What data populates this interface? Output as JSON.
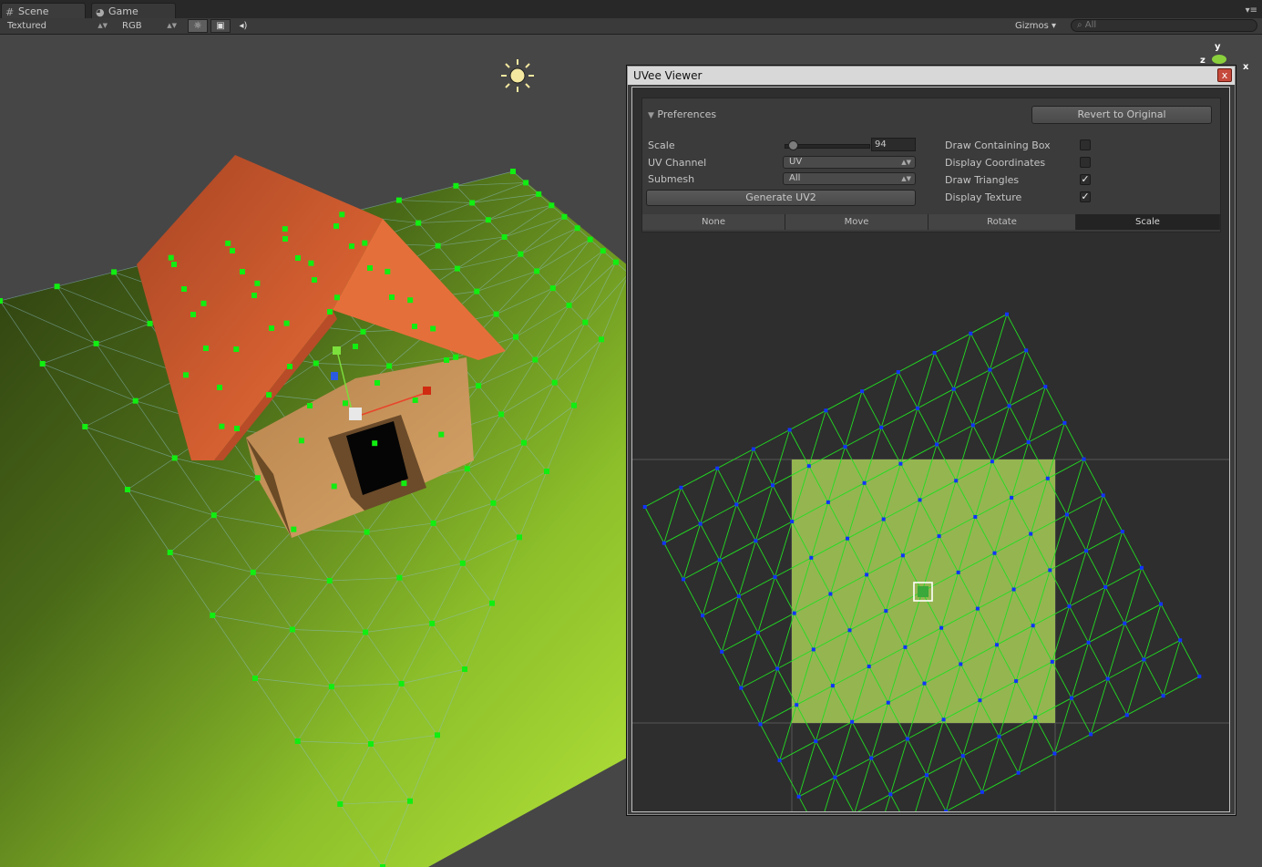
{
  "scene_tabs": [
    {
      "label": "Scene",
      "icon": "scene-grid-icon"
    },
    {
      "label": "Game",
      "icon": "game-pacman-icon"
    }
  ],
  "toolbar": {
    "draw_mode": "Textured",
    "render_mode": "RGB",
    "gizmos_label": "Gizmos",
    "search_placeholder": "All",
    "lighting_icon": "sun-icon",
    "image_icon": "image-icon",
    "audio_icon": "audio-icon"
  },
  "scene_gizmo": {
    "y_label": "y",
    "z_label": "z",
    "x_label": "x"
  },
  "uv_window": {
    "title": "UVee Viewer",
    "close_label": "x",
    "prefs_title": "Preferences",
    "revert_label": "Revert to Original",
    "scale_label": "Scale",
    "scale_value": "94",
    "scale_slider_fraction": 0.05,
    "uv_channel_label": "UV Channel",
    "uv_channel_value": "UV",
    "submesh_label": "Submesh",
    "submesh_value": "All",
    "generate_label": "Generate UV2",
    "options": [
      {
        "label": "Draw Containing Box",
        "checked": false
      },
      {
        "label": "Display Coordinates",
        "checked": false
      },
      {
        "label": "Draw Triangles",
        "checked": true
      },
      {
        "label": "Display Texture",
        "checked": true
      }
    ],
    "tools": [
      "None",
      "Move",
      "Rotate",
      "Scale"
    ],
    "active_tool": "Scale"
  },
  "colors": {
    "vertex_scene": "#11ee11",
    "vertex_uv": "#1133ff",
    "wire_uv": "#22dd22",
    "roof": "#c9582e",
    "ground": "#8ec52a"
  }
}
